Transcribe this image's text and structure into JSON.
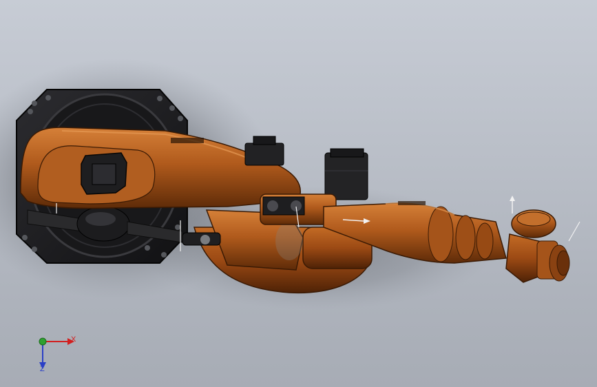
{
  "scene": {
    "type": "cad-3d-viewport",
    "model": "industrial-robot-arm",
    "background_top": "#c7ccd5",
    "background_bottom": "#a7acb5",
    "colors": {
      "arm_orange": "#b05a1c",
      "arm_highlight": "#d27a36",
      "arm_shadow": "#5a2a0a",
      "base_plate": "#1d1d1f",
      "motor_black": "#222224"
    }
  },
  "triad": {
    "x_label": "X",
    "z_label": "Z",
    "x_color": "#d21f1f",
    "y_color": "#2fa12f",
    "z_color": "#2a3fc6"
  }
}
